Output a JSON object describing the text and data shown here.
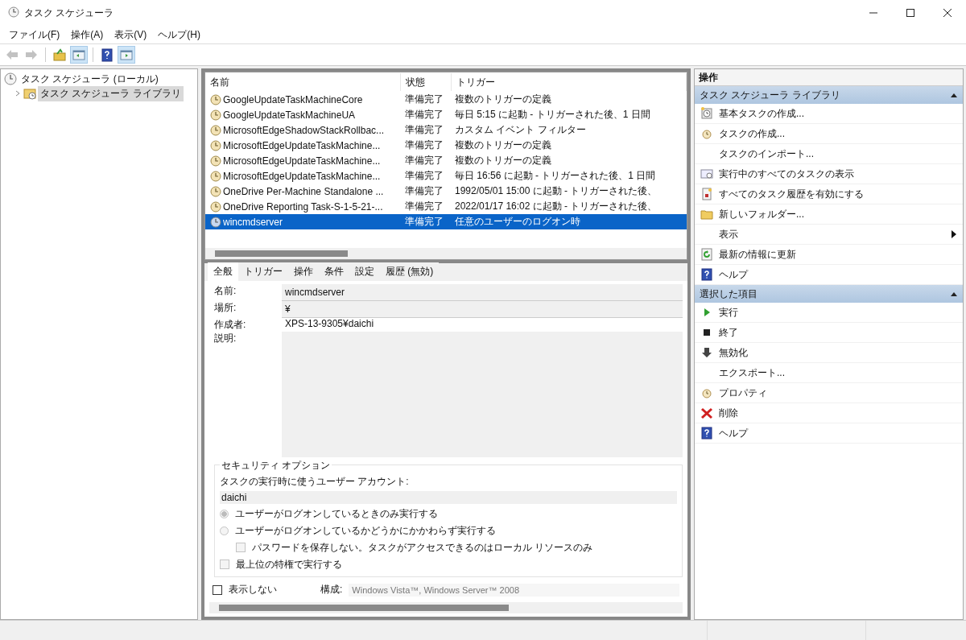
{
  "window": {
    "title": "タスク スケジューラ"
  },
  "menu": [
    {
      "label": "ファイル(F)"
    },
    {
      "label": "操作(A)"
    },
    {
      "label": "表示(V)"
    },
    {
      "label": "ヘルプ(H)"
    }
  ],
  "toolbar": [
    {
      "kind": "back",
      "disabled": true,
      "on": false
    },
    {
      "kind": "forward",
      "disabled": true,
      "on": false
    },
    {
      "kind": "up",
      "disabled": false,
      "on": false
    },
    {
      "kind": "tree",
      "disabled": false,
      "on": true
    },
    {
      "kind": "help",
      "disabled": false,
      "on": false
    },
    {
      "kind": "pane",
      "disabled": false,
      "on": true
    }
  ],
  "tree": [
    {
      "label": "タスク スケジューラ (ローカル)",
      "selected": false,
      "children": [
        {
          "label": "タスク スケジューラ ライブラリ",
          "selected": true,
          "expanded": false
        }
      ]
    }
  ],
  "task_list": {
    "columns": [
      "名前",
      "状態",
      "トリガー"
    ],
    "rows": [
      {
        "name": "GoogleUpdateTaskMachineCore",
        "status": "準備完了",
        "trigger": "複数のトリガーの定義",
        "selected": false
      },
      {
        "name": "GoogleUpdateTaskMachineUA",
        "status": "準備完了",
        "trigger": "毎日 5:15 に起動 - トリガーされた後、1 日間",
        "selected": false
      },
      {
        "name": "MicrosoftEdgeShadowStackRollbac...",
        "status": "準備完了",
        "trigger": "カスタム イベント フィルター",
        "selected": false
      },
      {
        "name": "MicrosoftEdgeUpdateTaskMachine...",
        "status": "準備完了",
        "trigger": "複数のトリガーの定義",
        "selected": false
      },
      {
        "name": "MicrosoftEdgeUpdateTaskMachine...",
        "status": "準備完了",
        "trigger": "複数のトリガーの定義",
        "selected": false
      },
      {
        "name": "MicrosoftEdgeUpdateTaskMachine...",
        "status": "準備完了",
        "trigger": "毎日 16:56 に起動 - トリガーされた後、1 日間",
        "selected": false
      },
      {
        "name": "OneDrive Per-Machine Standalone ...",
        "status": "準備完了",
        "trigger": "1992/05/01 15:00 に起動 - トリガーされた後、",
        "selected": false
      },
      {
        "name": "OneDrive Reporting Task-S-1-5-21-...",
        "status": "準備完了",
        "trigger": "2022/01/17 16:02 に起動 - トリガーされた後、",
        "selected": false
      },
      {
        "name": "wincmdserver",
        "status": "準備完了",
        "trigger": "任意のユーザーのログオン時",
        "selected": true
      }
    ]
  },
  "detail": {
    "tabs": [
      {
        "label": "全般",
        "selected": true
      },
      {
        "label": "トリガー",
        "selected": false
      },
      {
        "label": "操作",
        "selected": false
      },
      {
        "label": "条件",
        "selected": false
      },
      {
        "label": "設定",
        "selected": false
      },
      {
        "label": "履歴 (無効)",
        "selected": false
      }
    ],
    "fields": [
      {
        "label": "名前:",
        "value": "wincmdserver",
        "kind": "line"
      },
      {
        "label": "場所:",
        "value": "¥",
        "kind": "line"
      },
      {
        "label": "作成者:",
        "value": "XPS-13-9305¥daichi",
        "kind": "plain"
      },
      {
        "label": "説明:",
        "kind": "area"
      }
    ],
    "security": {
      "title": "セキュリティ オプション",
      "account_label": "タスクの実行時に使うユーザー アカウント:",
      "account": "daichi",
      "options": [
        {
          "label": "ユーザーがログオンしているときのみ実行する",
          "kind": "radio",
          "selected": true,
          "disabled": true
        },
        {
          "label": "ユーザーがログオンしているかどうかにかかわらず実行する",
          "kind": "radio",
          "selected": false,
          "disabled": true
        },
        {
          "label": "パスワードを保存しない。タスクがアクセスできるのはローカル リソースのみ",
          "kind": "subcheck",
          "checked": false,
          "disabled": true
        },
        {
          "label": "最上位の特権で実行する",
          "kind": "check",
          "checked": false,
          "disabled": true
        }
      ]
    },
    "hidden": {
      "label": "表示しない",
      "checked": false
    },
    "config": {
      "label": "構成:",
      "value": "Windows Vista™, Windows Server™ 2008"
    }
  },
  "actions": {
    "title": "操作",
    "sections": [
      {
        "title": "タスク スケジューラ ライブラリ",
        "expanded": true,
        "items": [
          {
            "label": "基本タスクの作成...",
            "kind": "wizard"
          },
          {
            "label": "タスクの作成...",
            "kind": "task"
          },
          {
            "label": "タスクのインポート...",
            "kind": "none"
          },
          {
            "label": "実行中のすべてのタスクの表示",
            "kind": "running"
          },
          {
            "label": "すべてのタスク履歴を有効にする",
            "kind": "history"
          },
          {
            "label": "新しいフォルダー...",
            "kind": "folder"
          },
          {
            "label": "表示",
            "kind": "submenu"
          },
          {
            "label": "最新の情報に更新",
            "kind": "refresh"
          },
          {
            "label": "ヘルプ",
            "kind": "help"
          }
        ]
      },
      {
        "title": "選択した項目",
        "expanded": true,
        "items": [
          {
            "label": "実行",
            "kind": "run"
          },
          {
            "label": "終了",
            "kind": "stop"
          },
          {
            "label": "無効化",
            "kind": "disable"
          },
          {
            "label": "エクスポート...",
            "kind": "none"
          },
          {
            "label": "プロパティ",
            "kind": "task"
          },
          {
            "label": "削除",
            "kind": "delete"
          },
          {
            "label": "ヘルプ",
            "kind": "help"
          }
        ]
      }
    ]
  }
}
